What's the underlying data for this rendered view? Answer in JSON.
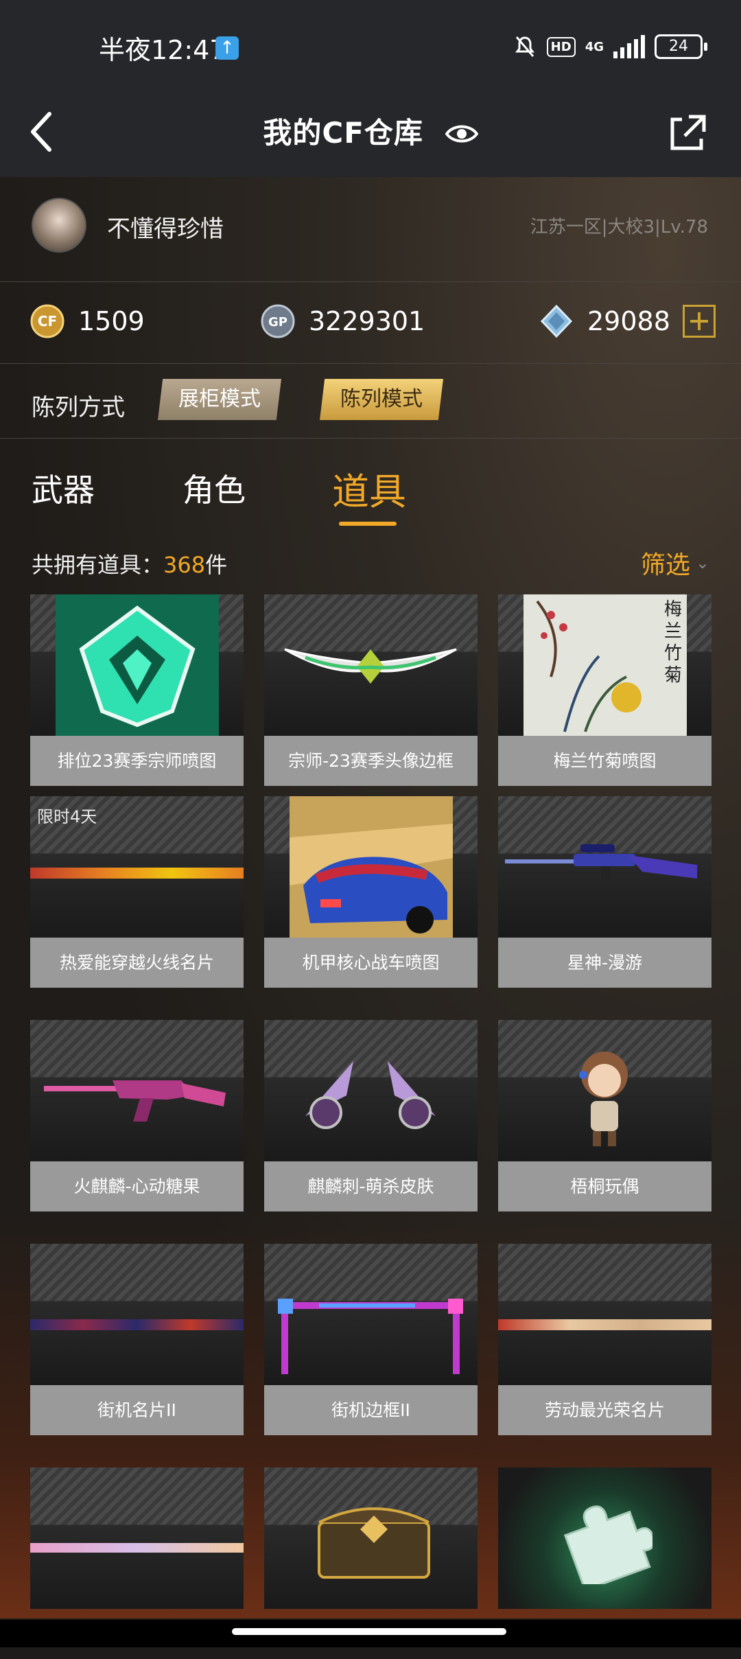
{
  "status_bar": {
    "time": "半夜12:47",
    "network": "4G",
    "hd": "HD",
    "battery": "24"
  },
  "header": {
    "title": "我的CF仓库"
  },
  "profile": {
    "username": "不懂得珍惜",
    "server_info": "江苏一区|大校3|Lv.78"
  },
  "currency": {
    "cf_points": "1509",
    "gp_label": "GP",
    "gp": "3229301",
    "diamond": "29088"
  },
  "display_mode": {
    "label": "陈列方式",
    "cabinet_mode": "展柜模式",
    "list_mode": "陈列模式"
  },
  "tabs": [
    {
      "label": "武器",
      "active": false
    },
    {
      "label": "角色",
      "active": false
    },
    {
      "label": "道具",
      "active": true
    }
  ],
  "items_summary": {
    "prefix": "共拥有道具：",
    "count": "368",
    "suffix": "件",
    "filter_label": "筛选"
  },
  "items": [
    {
      "name": "排位23赛季宗师喷图",
      "badge": ""
    },
    {
      "name": "宗师-23赛季头像边框",
      "badge": ""
    },
    {
      "name": "梅兰竹菊喷图",
      "badge": ""
    },
    {
      "name": "热爱能穿越火线名片",
      "badge": "限时4天"
    },
    {
      "name": "机甲核心战车喷图",
      "badge": ""
    },
    {
      "name": "星神-漫游",
      "badge": ""
    },
    {
      "name": "火麒麟-心动糖果",
      "badge": ""
    },
    {
      "name": "麒麟刺-萌杀皮肤",
      "badge": ""
    },
    {
      "name": "梧桐玩偶",
      "badge": ""
    },
    {
      "name": "街机名片II",
      "badge": ""
    },
    {
      "name": "街机边框II",
      "badge": ""
    },
    {
      "name": "劳动最光荣名片",
      "badge": ""
    },
    {
      "name": "",
      "badge": ""
    },
    {
      "name": "",
      "badge": ""
    },
    {
      "name": "",
      "badge": ""
    }
  ],
  "colors": {
    "accent": "#f2a927",
    "header_bg": "#26272b",
    "card_label_bg": "#9a9a9a"
  }
}
